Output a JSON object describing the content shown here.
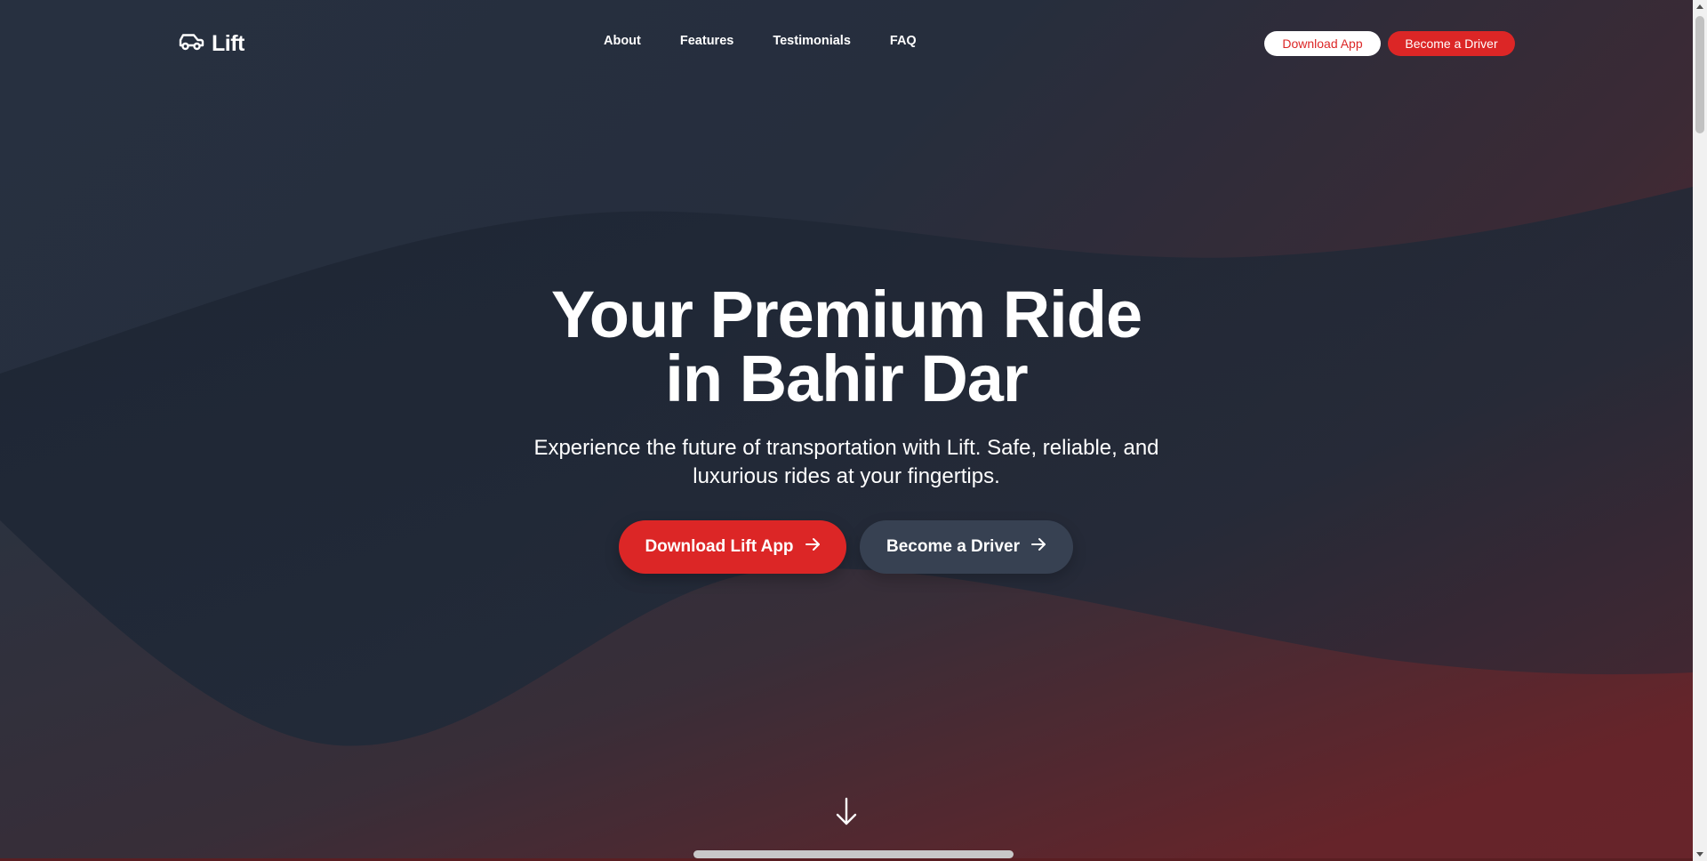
{
  "brand": {
    "name": "Lift",
    "logo_icon": "car-icon"
  },
  "nav": {
    "links": [
      "About",
      "Features",
      "Testimonials",
      "FAQ"
    ],
    "download_app": "Download App",
    "become_driver": "Become a Driver"
  },
  "hero": {
    "title_line1": "Your Premium Ride",
    "title_line2": "in Bahir Dar",
    "subtitle_line1": "Experience the future of transportation with Lift. Safe, reliable, and",
    "subtitle_line2": "luxurious rides at your fingertips.",
    "cta_primary": "Download Lift App",
    "cta_secondary": "Become a Driver",
    "cta_icon": "arrow-right-icon",
    "scroll_icon": "arrow-down-icon"
  },
  "colors": {
    "accent": "#dc2626",
    "background_dark": "#1f2633",
    "secondary_button": "#374152"
  }
}
